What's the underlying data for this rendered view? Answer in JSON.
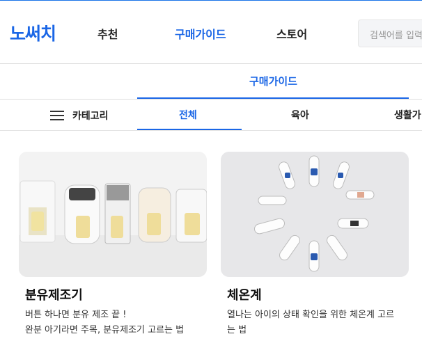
{
  "header": {
    "logo": "노써치",
    "nav": [
      "추천",
      "구매가이드",
      "스토어"
    ],
    "active_nav": "구매가이드",
    "search_placeholder": "검색어를 입력하"
  },
  "section": {
    "title": "구매가이드"
  },
  "tabs": {
    "category_label": "카테고리",
    "items": [
      "전체",
      "육아",
      "생활가"
    ],
    "active": "전체"
  },
  "cards": [
    {
      "title": "분유제조기",
      "desc_line1": "버튼 하나면 분유 제조 끝 !",
      "desc_line2": "완분 아기라면 주목, 분유제조기 고르는 법",
      "image": "formula-maker-products-photo"
    },
    {
      "title": "체온계",
      "desc": "열나는 아이의 상태 확인을 위한 체온계 고르는 법",
      "image": "thermometers-circle-photo"
    }
  ],
  "colors": {
    "accent": "#1a66e6",
    "border": "#dcdcdc"
  }
}
